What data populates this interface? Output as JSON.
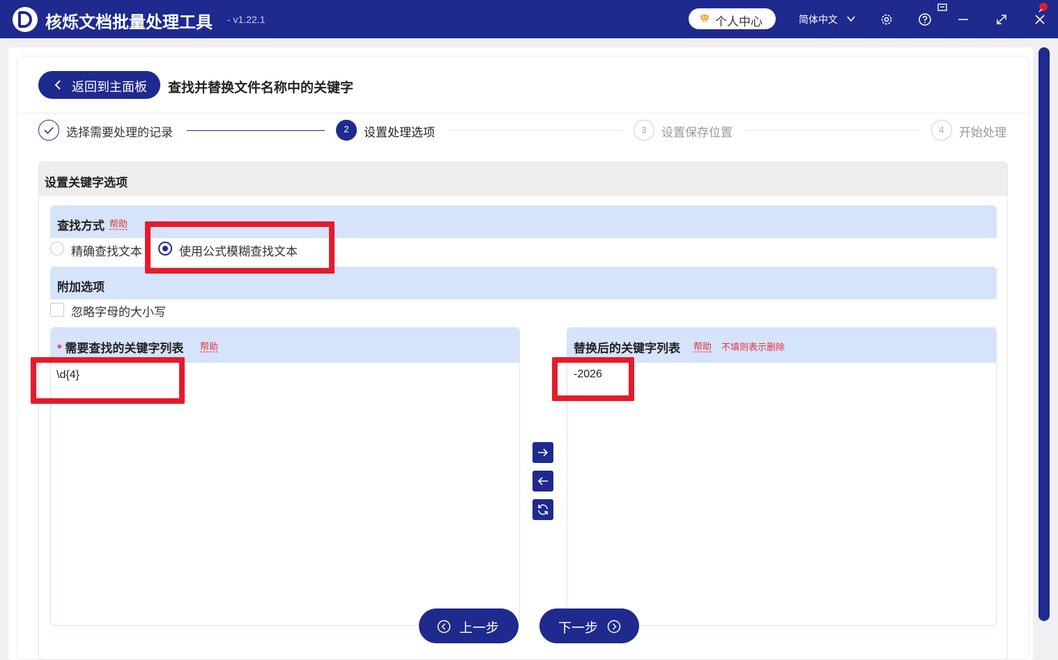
{
  "app": {
    "title": "核烁文档批量处理工具",
    "version": "- v1.22.1",
    "user_center": "个人中心",
    "language": "简体中文"
  },
  "header": {
    "back_label": "返回到主面板",
    "page_title": "查找并替换文件名称中的关键字"
  },
  "steps": [
    {
      "number": "",
      "label": "选择需要处理的记录",
      "state": "done"
    },
    {
      "number": "2",
      "label": "设置处理选项",
      "state": "active"
    },
    {
      "number": "3",
      "label": "设置保存位置",
      "state": "pending"
    },
    {
      "number": "4",
      "label": "开始处理",
      "state": "pending"
    }
  ],
  "panel": {
    "title": "设置关键字选项",
    "search_mode": {
      "title": "查找方式",
      "help": "帮助",
      "options": [
        "精确查找文本",
        "使用公式模糊查找文本"
      ],
      "selected": "使用公式模糊查找文本"
    },
    "extra": {
      "title": "附加选项",
      "ignore_case_label": "忽略字母的大小写",
      "ignore_case_checked": false
    },
    "find_list": {
      "required_mark": "*",
      "title": "需要查找的关键字列表",
      "help": "帮助",
      "items": [
        "\\d{4}"
      ]
    },
    "replace_list": {
      "title": "替换后的关键字列表",
      "help": "帮助",
      "note": "不填则表示删除",
      "items": [
        "-2026"
      ]
    }
  },
  "nav": {
    "prev_label": "上一步",
    "next_label": "下一步"
  },
  "colors": {
    "primary": "#1e2a8e",
    "section_bg": "#d5e3fb",
    "highlight": "#e51b2b",
    "help_red": "#e8333a"
  }
}
